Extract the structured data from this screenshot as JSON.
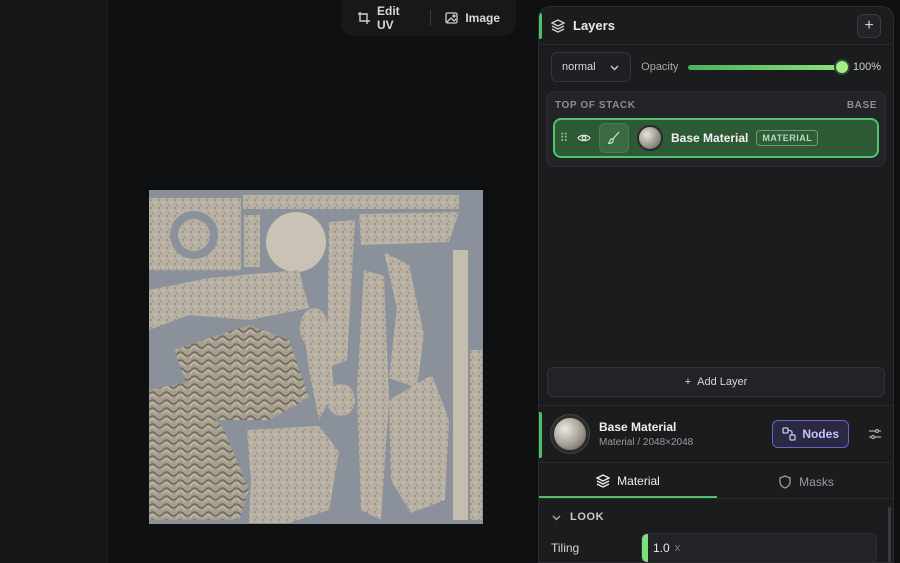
{
  "toolbar": {
    "edit_uv_label": "Edit UV",
    "image_label": "Image"
  },
  "layers_panel": {
    "title": "Layers",
    "blend_mode": "normal",
    "opacity_label": "Opacity",
    "opacity_value": "100%",
    "opacity_fraction": 1.0,
    "stack_top_label": "TOP OF STACK",
    "stack_base_label": "BASE",
    "layers": [
      {
        "name": "Base Material",
        "badge": "MATERIAL"
      }
    ],
    "add_layer_label": "Add Layer"
  },
  "material": {
    "title": "Base Material",
    "subtitle": "Material / 2048×2048",
    "nodes_label": "Nodes"
  },
  "tabs": [
    {
      "label": "Material"
    },
    {
      "label": "Masks"
    }
  ],
  "look_section": {
    "title": "LOOK",
    "tiling_label": "Tiling",
    "tiling_value": "1.0",
    "tiling_unit": "x"
  },
  "colors": {
    "accent_green": "#4ec06a",
    "nodes_purple": "#6c62c8",
    "texture_bg": "#8a919b"
  }
}
